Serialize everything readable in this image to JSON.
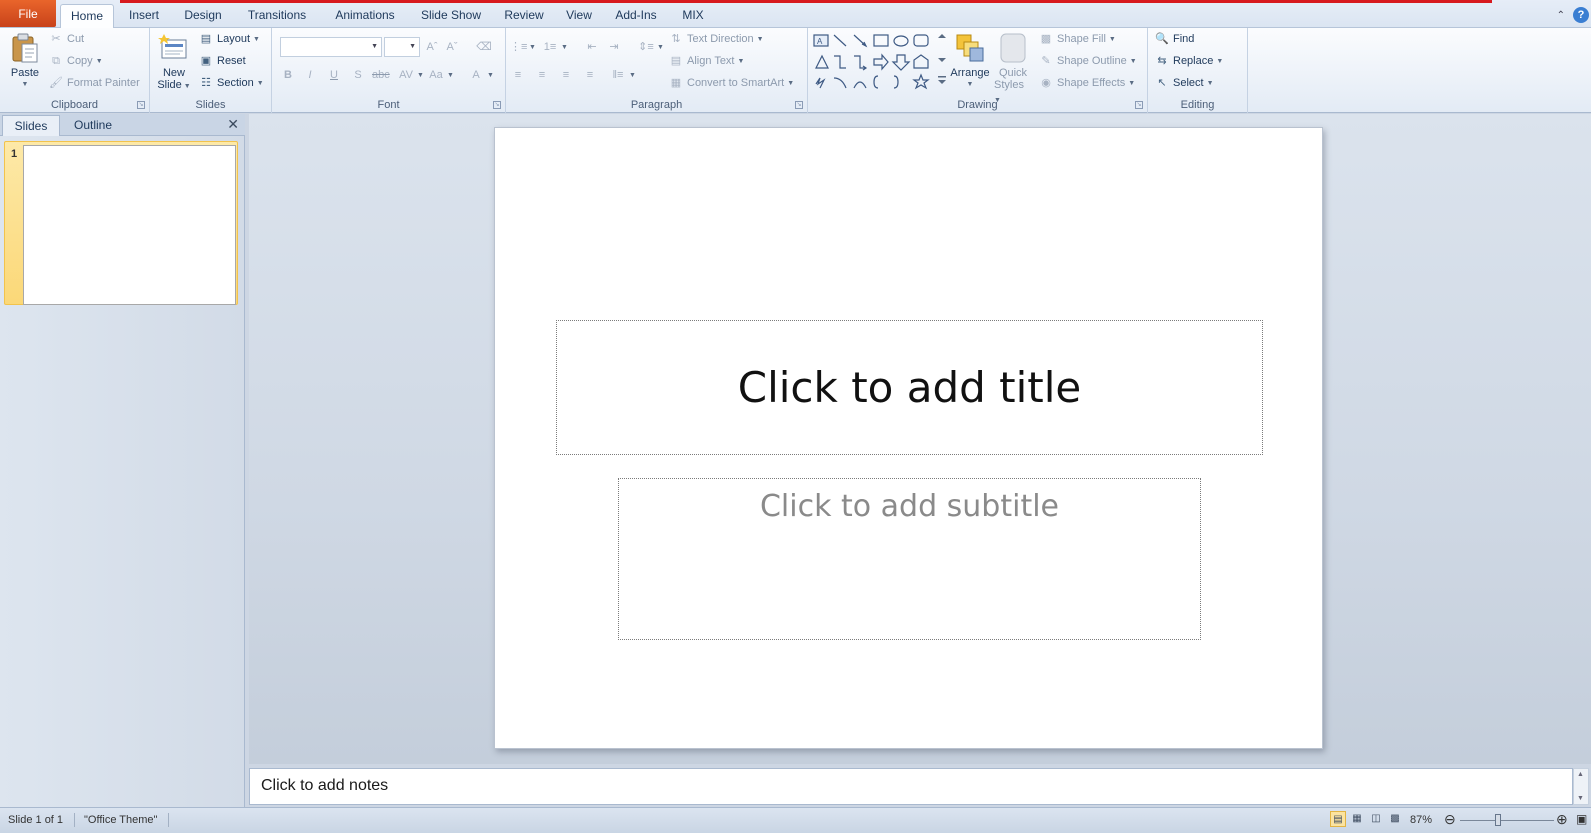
{
  "tabs": {
    "file": "File",
    "items": [
      "Home",
      "Insert",
      "Design",
      "Transitions",
      "Animations",
      "Slide Show",
      "Review",
      "View",
      "Add-Ins",
      "MIX"
    ],
    "active": "Home"
  },
  "ribbon": {
    "clipboard": {
      "label": "Clipboard",
      "paste": "Paste",
      "cut": "Cut",
      "copy": "Copy",
      "format_painter": "Format Painter"
    },
    "slides": {
      "label": "Slides",
      "new_slide_1": "New",
      "new_slide_2": "Slide",
      "layout": "Layout",
      "reset": "Reset",
      "section": "Section"
    },
    "font": {
      "label": "Font",
      "font_name": "",
      "font_size": ""
    },
    "paragraph": {
      "label": "Paragraph",
      "text_direction": "Text Direction",
      "align_text": "Align Text",
      "convert_smartart": "Convert to SmartArt"
    },
    "drawing": {
      "label": "Drawing",
      "arrange": "Arrange",
      "quick_styles_1": "Quick",
      "quick_styles_2": "Styles",
      "shape_fill": "Shape Fill",
      "shape_outline": "Shape Outline",
      "shape_effects": "Shape Effects"
    },
    "editing": {
      "label": "Editing",
      "find": "Find",
      "replace": "Replace",
      "select": "Select"
    }
  },
  "left_pane": {
    "tab_slides": "Slides",
    "tab_outline": "Outline",
    "slide_number": "1"
  },
  "slide": {
    "title_placeholder": "Click to add title",
    "subtitle_placeholder": "Click to add subtitle"
  },
  "notes": {
    "placeholder": "Click to add notes"
  },
  "status": {
    "slide_info": "Slide 1 of 1",
    "theme": "\"Office Theme\"",
    "zoom": "87%",
    "zoom_level": 0.87
  },
  "colors": {
    "file_tab": "#d8541e",
    "accent_redline": "#d7191e",
    "selected_thumb": "#fbd878"
  }
}
